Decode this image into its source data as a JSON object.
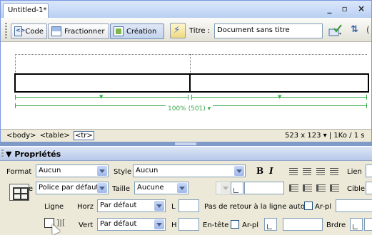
{
  "document": {
    "tab_title": "Untitled-1*",
    "window_controls": "_ ▫ ×"
  },
  "toolbar": {
    "code_label": "Code",
    "split_label": "Fractionner",
    "design_label": "Création",
    "title_label": "Titre :",
    "title_value": "Document sans titre"
  },
  "canvas": {
    "table_width_label": "100% (501)"
  },
  "statusbar": {
    "tags": [
      "<body>",
      "<table>",
      "<tr>"
    ],
    "dimensions": "523 x 123",
    "size_speed": "1Ko / 1 s"
  },
  "properties": {
    "title": "Propriétés",
    "row1": {
      "format_label": "Format",
      "format_value": "Aucun",
      "style_label": "Style",
      "style_value": "Aucun",
      "bold": "B",
      "italic": "I",
      "link_label": "Lien"
    },
    "row2": {
      "font_label": "Police",
      "font_value": "Police par défaut",
      "size_label": "Taille",
      "size_value": "Aucune",
      "target_label": "Cible"
    },
    "row3": {
      "row_label": "Ligne",
      "horz_label": "Horz",
      "horz_value": "Par défaut",
      "w_label": "L",
      "nowrap_label": "Pas de retour à la ligne auto",
      "bg_label": "Ar-pl"
    },
    "row4": {
      "vert_label": "Vert",
      "vert_value": "Par défaut",
      "h_label": "H",
      "header_label": "En-tête",
      "bg_label": "Ar-pl",
      "border_label": "Brdre"
    }
  }
}
